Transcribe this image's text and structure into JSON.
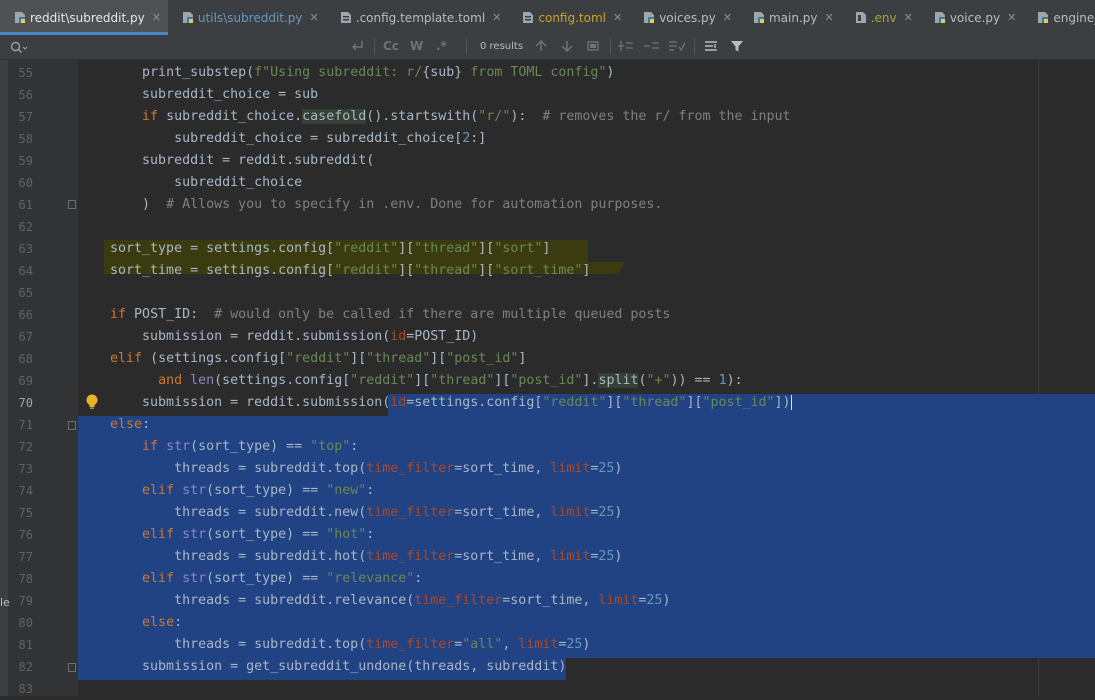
{
  "tabs": [
    {
      "label": "reddit\\subreddit.py",
      "icon": "python-file-icon",
      "active": true,
      "color": "default"
    },
    {
      "label": "utils\\subreddit.py",
      "icon": "python-file-icon",
      "active": false,
      "color": "blue"
    },
    {
      "label": ".config.template.toml",
      "icon": "toml-file-icon",
      "active": false,
      "color": "default"
    },
    {
      "label": "config.toml",
      "icon": "toml-file-icon",
      "active": false,
      "color": "gold"
    },
    {
      "label": "voices.py",
      "icon": "python-file-icon",
      "active": false,
      "color": "default"
    },
    {
      "label": "main.py",
      "icon": "python-file-icon",
      "active": false,
      "color": "default"
    },
    {
      "label": ".env",
      "icon": "env-file-icon",
      "active": false,
      "color": "olive"
    },
    {
      "label": "voice.py",
      "icon": "python-file-icon",
      "active": false,
      "color": "default"
    },
    {
      "label": "engine_wrapper.py",
      "icon": "python-file-icon",
      "active": false,
      "color": "default"
    }
  ],
  "search": {
    "placeholder": "",
    "results": "0 results",
    "case_label": "Cc",
    "word_label": "W",
    "regex_label": ".*"
  },
  "editor": {
    "line_numbers": [
      "55",
      "56",
      "57",
      "58",
      "59",
      "60",
      "61",
      "62",
      "63",
      "64",
      "65",
      "66",
      "67",
      "68",
      "69",
      "70",
      "71",
      "72",
      "73",
      "74",
      "75",
      "76",
      "77",
      "78",
      "79",
      "80",
      "81",
      "82",
      "83"
    ],
    "current_line": "70",
    "left_panel_fragment": "le",
    "colors": {
      "keyword": "#cc7832",
      "string": "#6a8759",
      "comment": "#808080",
      "number": "#6897bb",
      "selection": "#214283",
      "highlight": "#3b3b10"
    }
  }
}
